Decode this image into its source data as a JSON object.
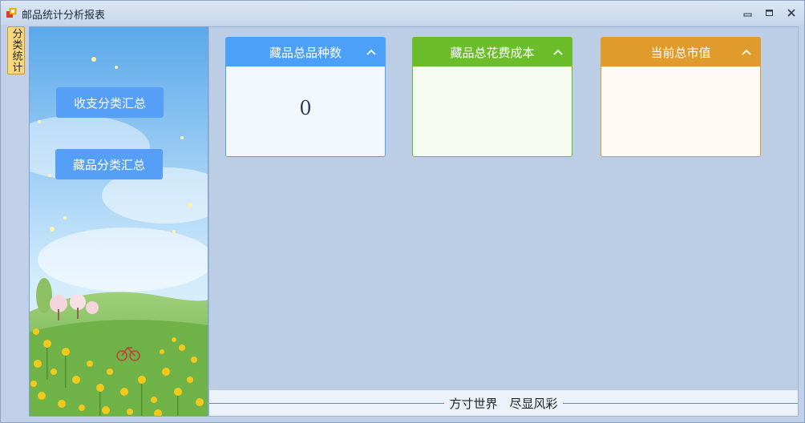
{
  "window": {
    "title": "邮品统计分析报表"
  },
  "side_tab": {
    "label": "分类统计"
  },
  "nav": {
    "buttons": [
      {
        "label": "收支分类汇总"
      },
      {
        "label": "藏品分类汇总"
      }
    ]
  },
  "cards": [
    {
      "title": "藏品总品种数",
      "value": "0",
      "head_color": "#4da0f8",
      "body_color": "#f3f8ff",
      "border_color": "#4da0f8"
    },
    {
      "title": "藏品总花费成本",
      "value": "",
      "head_color": "#6cbd2a",
      "body_color": "#f6fbf1",
      "border_color": "#6cbd2a"
    },
    {
      "title": "当前总市值",
      "value": "",
      "head_color": "#e09b2c",
      "body_color": "#fffaf3",
      "border_color": "#e09b2c"
    }
  ],
  "footer": {
    "slogan": "方寸世界　尽显风彩"
  }
}
